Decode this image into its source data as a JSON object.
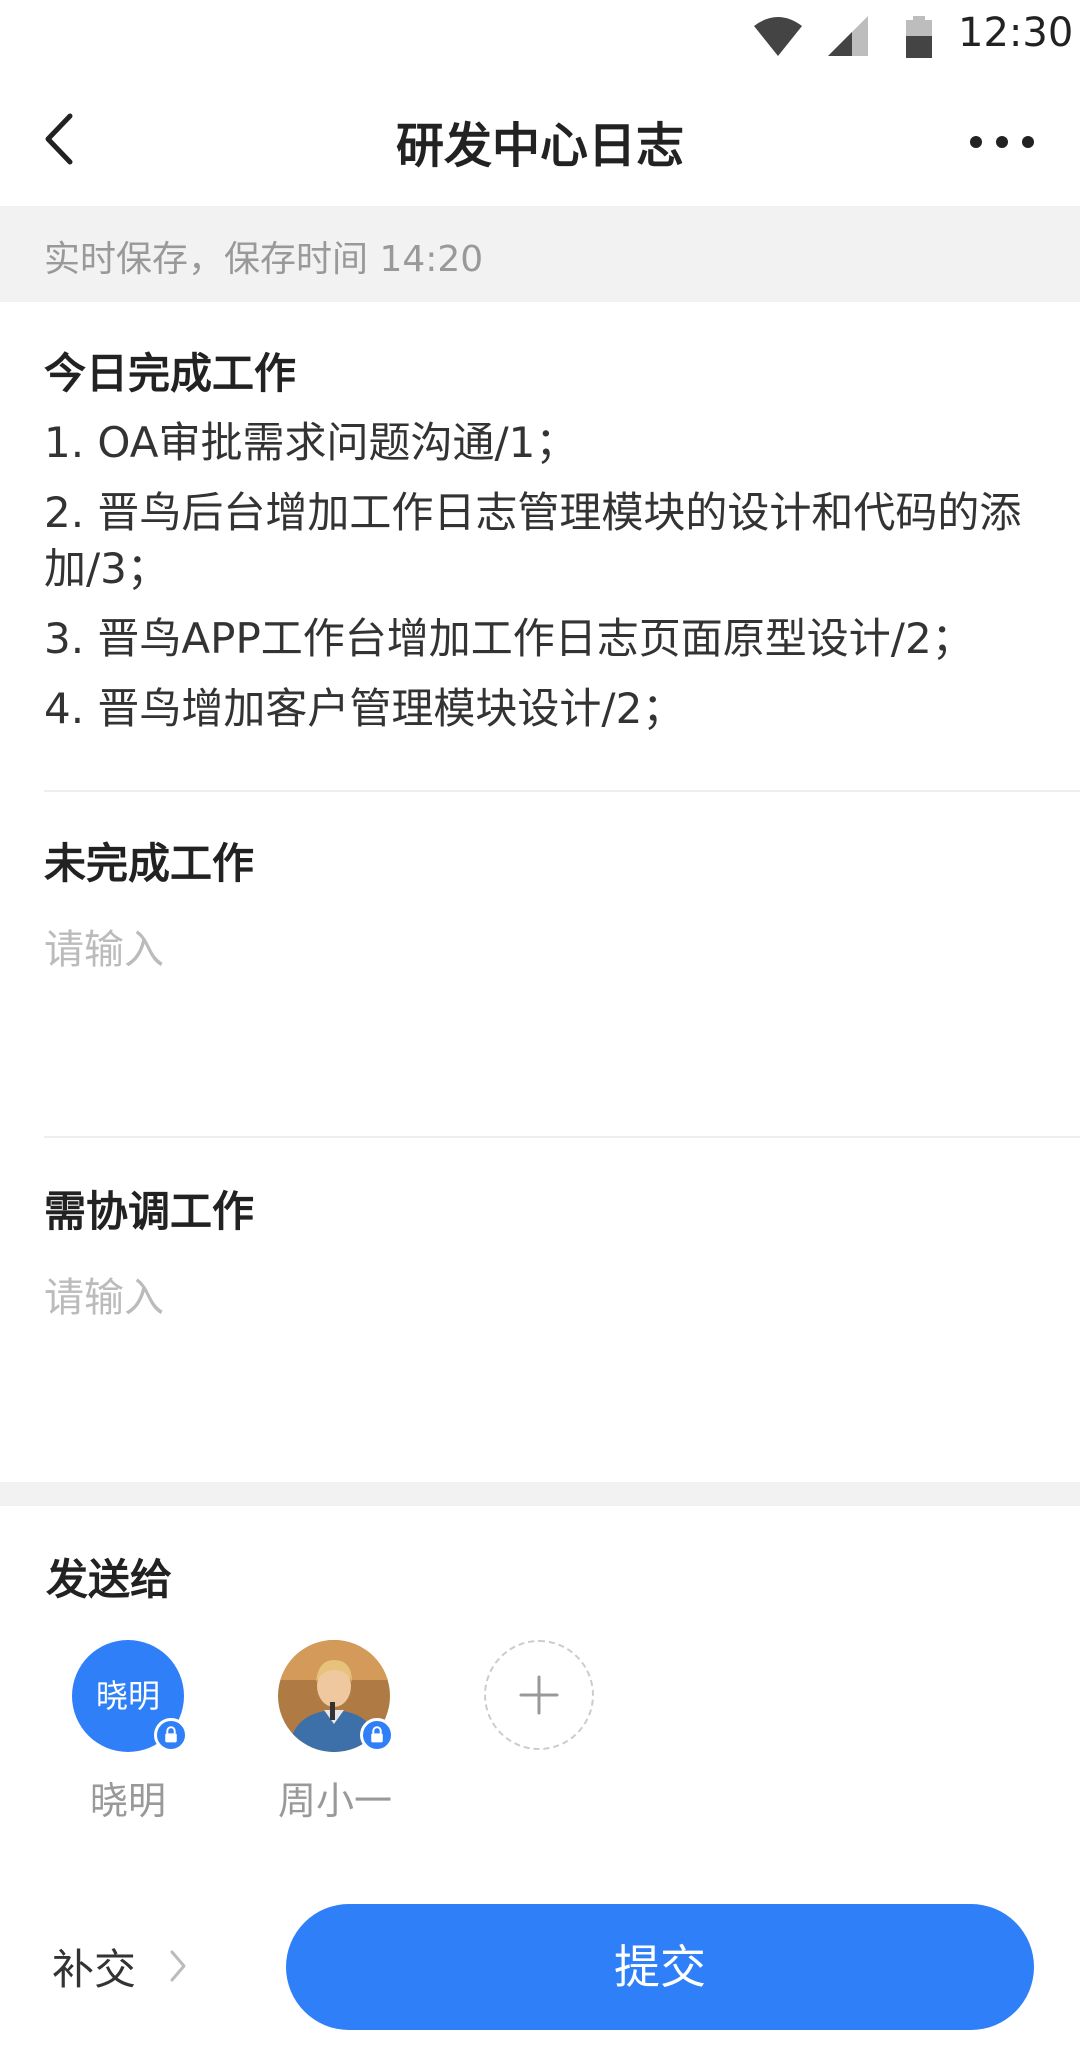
{
  "status_bar": {
    "time": "12:30",
    "icons": [
      "wifi-icon",
      "cell-signal-icon",
      "battery-icon"
    ]
  },
  "nav": {
    "title": "研发中心日志",
    "back_icon": "chevron-left-icon",
    "more_icon": "more-dots-icon"
  },
  "save_notice": "实时保存，保存时间 14:20",
  "sections": {
    "completed": {
      "title": "今日完成工作",
      "lines": [
        "1. OA审批需求问题沟通/1；",
        "2. 晋鸟后台增加工作日志管理模块的设计和代码的添加/3；",
        "3. 晋鸟APP工作台增加工作日志页面原型设计/2；",
        "4. 晋鸟增加客户管理模块设计/2；"
      ]
    },
    "unfinished": {
      "title": "未完成工作",
      "placeholder": "请输入"
    },
    "coordination": {
      "title": "需协调工作",
      "placeholder": "请输入"
    }
  },
  "send_to": {
    "title": "发送给",
    "recipients": [
      {
        "avatar_text": "晓明",
        "name": "晓明",
        "locked": true
      },
      {
        "avatar_text": "",
        "name": "周小一",
        "locked": true
      }
    ],
    "add_icon": "plus-icon"
  },
  "actions": {
    "resubmit_label": "补交",
    "submit_label": "提交"
  },
  "colors": {
    "accent": "#2f7ff8",
    "background_band": "#f2f2f2",
    "placeholder": "#bbbbbb"
  }
}
